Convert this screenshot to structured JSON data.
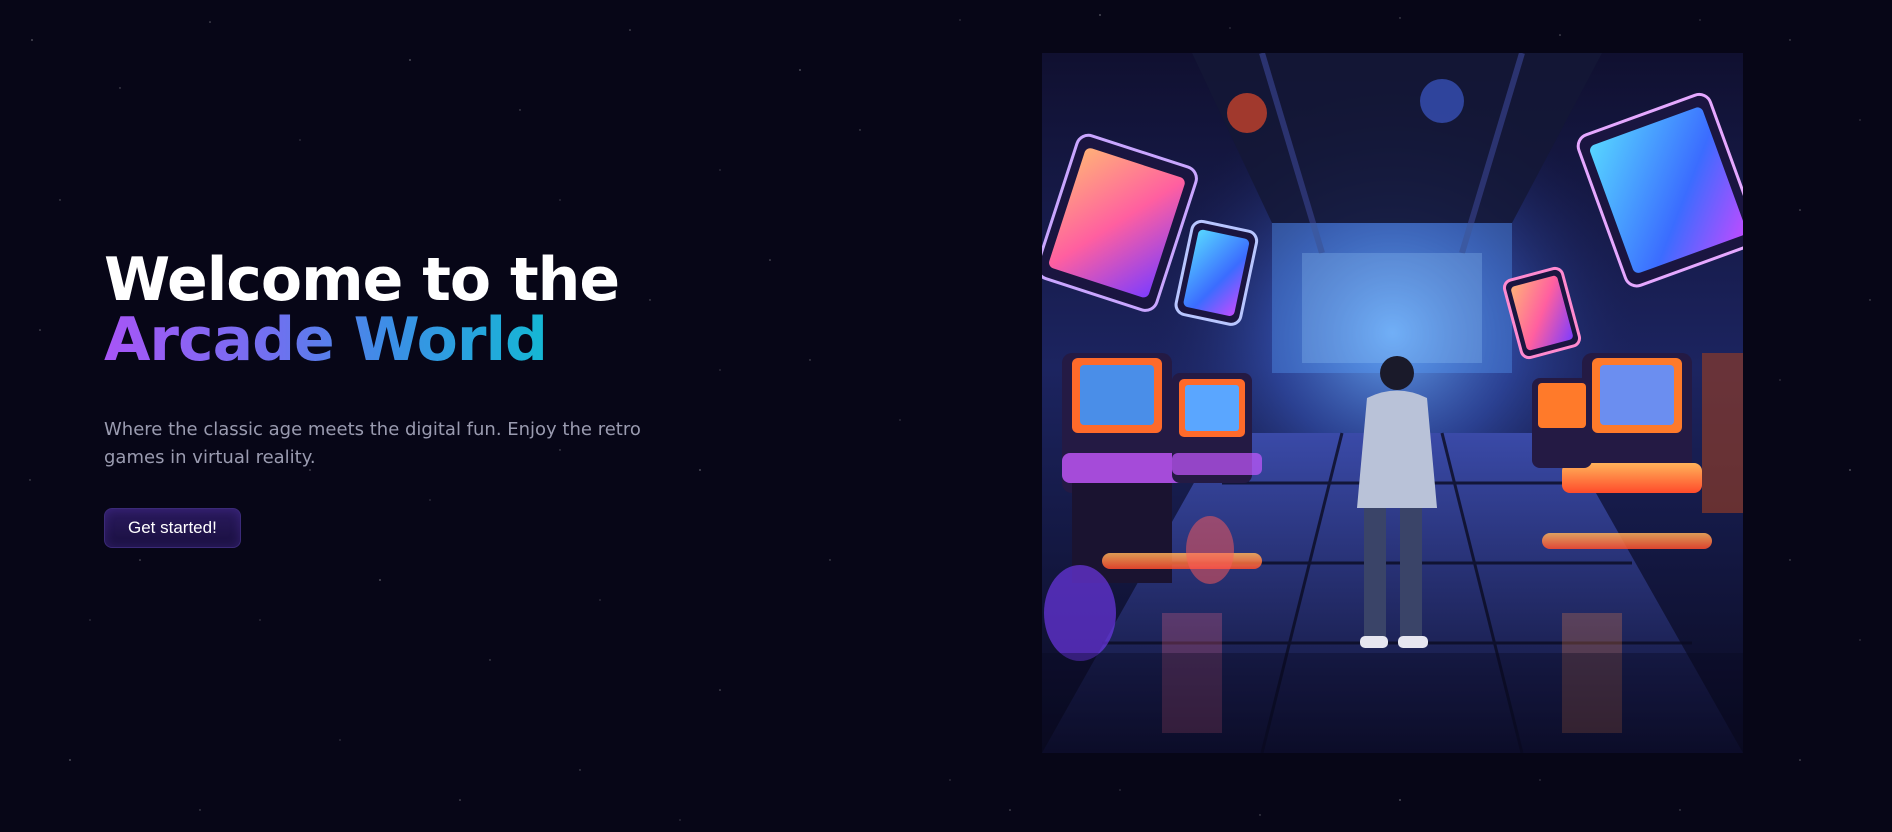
{
  "hero": {
    "headline_line1": "Welcome to the",
    "headline_line2": "Arcade World",
    "subtitle": "Where the classic age meets the digital fun. Enjoy the retro games in virtual reality.",
    "cta_label": "Get started!"
  },
  "colors": {
    "background": "#070617",
    "gradient_start": "#a855f7",
    "gradient_end": "#14b8d4",
    "subtitle": "#9a9bb0",
    "button": "#2a1a5e"
  }
}
